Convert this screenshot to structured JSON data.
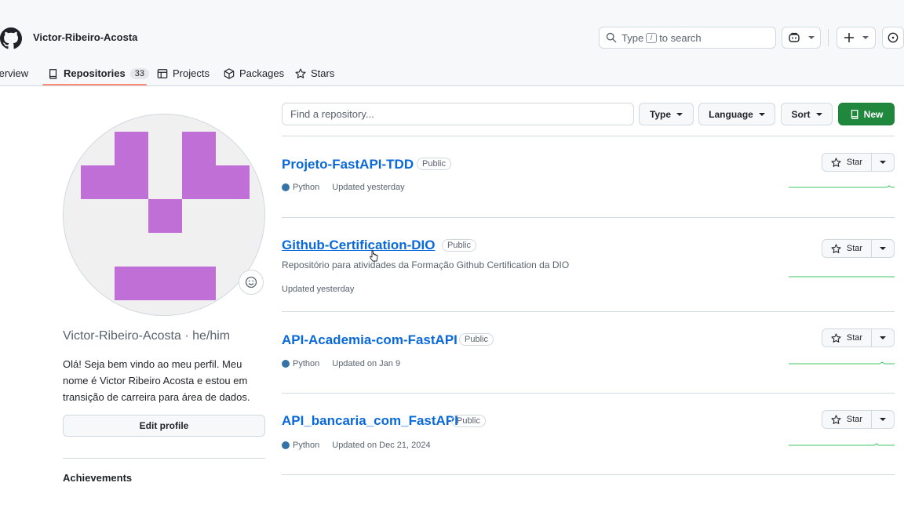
{
  "header": {
    "username": "Victor-Ribeiro-Acosta",
    "search_placeholder_pre": "Type",
    "search_key": "/",
    "search_placeholder_post": "to search"
  },
  "tabs": [
    {
      "label": "Overview"
    },
    {
      "label": "Repositories",
      "count": "33"
    },
    {
      "label": "Projects"
    },
    {
      "label": "Packages"
    },
    {
      "label": "Stars"
    }
  ],
  "profile": {
    "name": "Victor-Ribeiro-Acosta · he/him",
    "bio": "Olá! Seja bem vindo ao meu perfil. Meu nome é Victor Ribeiro Acosta e estou em transição de carreira para área de dados.",
    "edit_label": "Edit profile",
    "achievements_label": "Achievements"
  },
  "filters": {
    "find_placeholder": "Find a repository...",
    "type_label": "Type",
    "language_label": "Language",
    "sort_label": "Sort",
    "new_label": "New"
  },
  "repos": [
    {
      "name": "Projeto-FastAPI-TDD",
      "visibility": "Public",
      "language": "Python",
      "updated": "Updated yesterday",
      "star_label": "Star"
    },
    {
      "name": "Github-Certification-DIO",
      "visibility": "Public",
      "description": "Repositório para atividades da Formação Github Certification da DIO",
      "updated": "Updated yesterday",
      "star_label": "Star"
    },
    {
      "name": "API-Academia-com-FastAPI",
      "visibility": "Public",
      "language": "Python",
      "updated": "Updated on Jan 9",
      "star_label": "Star"
    },
    {
      "name": "API_bancaria_com_FastAPI",
      "visibility": "Public",
      "language": "Python",
      "updated": "Updated on Dec 21, 2024",
      "star_label": "Star"
    }
  ],
  "colors": {
    "link": "#0969da",
    "new_button": "#1f883d",
    "python": "#3572a5",
    "avatar_pixels": "#c06fd6",
    "tab_underline": "#fd8c73"
  }
}
